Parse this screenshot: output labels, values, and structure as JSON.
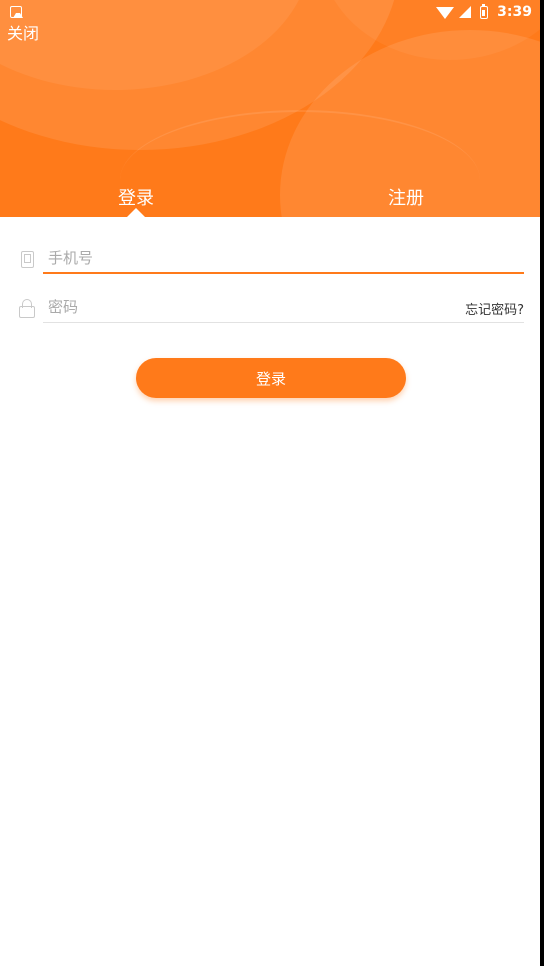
{
  "status_bar": {
    "time": "3:39",
    "icons": [
      "notification-icon",
      "wifi-icon",
      "signal-icon",
      "battery-icon"
    ]
  },
  "header": {
    "close_label": "关闭",
    "tabs": [
      {
        "label": "登录",
        "active": true
      },
      {
        "label": "注册",
        "active": false
      }
    ],
    "background_color": "#ff7a1a"
  },
  "form": {
    "phone": {
      "placeholder": "手机号",
      "value": "",
      "icon": "phone-icon"
    },
    "password": {
      "placeholder": "密码",
      "value": "",
      "icon": "lock-icon"
    },
    "forgot_label": "忘记密码?",
    "submit_label": "登录"
  },
  "colors": {
    "accent": "#ff7a1a",
    "placeholder": "#aaaaaa",
    "divider": "#e2e2e2"
  }
}
